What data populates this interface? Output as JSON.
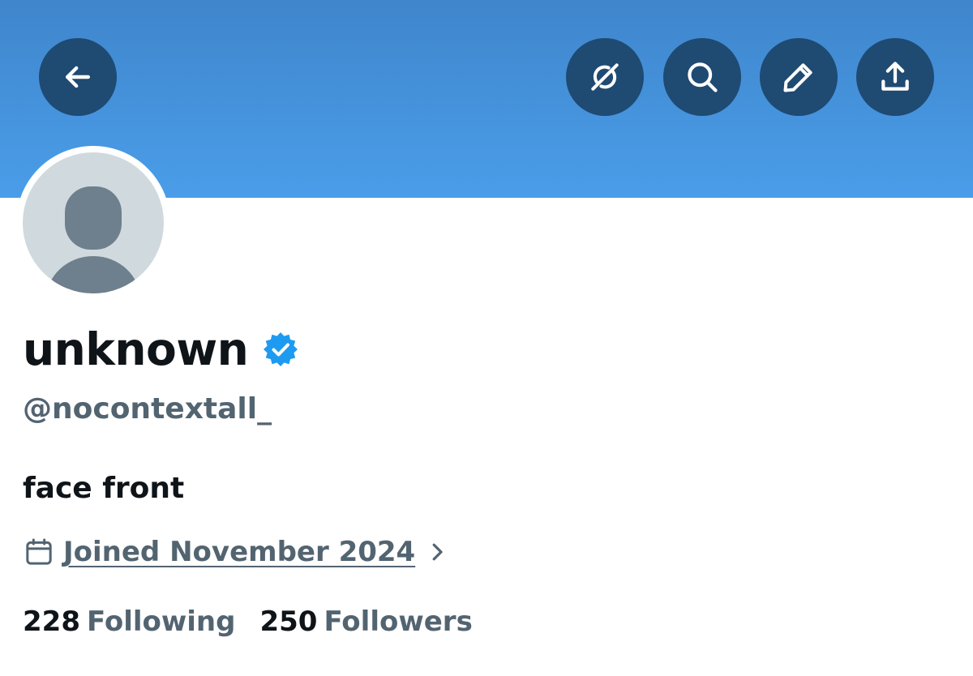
{
  "header": {
    "back_icon": "arrow-left-icon",
    "action_icons": [
      "grok-icon",
      "search-icon",
      "pencil-icon",
      "share-icon"
    ]
  },
  "profile": {
    "display_name": "unknown",
    "verified": true,
    "handle": "@nocontextall_",
    "bio": "face front",
    "joined": "Joined November 2024",
    "following_count": "228",
    "following_label": "Following",
    "followers_count": "250",
    "followers_label": "Followers"
  },
  "colors": {
    "banner": "#4a9de9",
    "button_bg": "#1f4a72",
    "verified_badge": "#1d9bf0",
    "primary_text": "#0f1419",
    "secondary_text": "#536471",
    "avatar_bg": "#cfd9de"
  }
}
